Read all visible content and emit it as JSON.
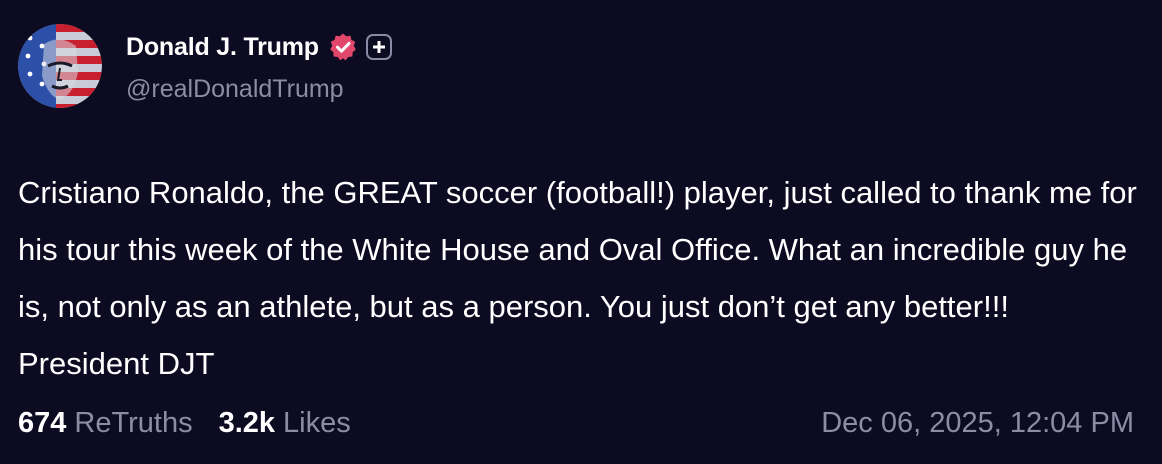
{
  "author": {
    "display_name": "Donald J. Trump",
    "handle": "@realDonaldTrump",
    "verified_icon": "verified-badge-icon",
    "plus_icon": "plus-square-icon"
  },
  "post": {
    "text": "Cristiano Ronaldo, the GREAT soccer (football!) player, just called to thank me for his tour this week of the White House and Oval Office. What an incredible guy he is, not only as an athlete, but as a person. You just don’t get any better!!! President DJT"
  },
  "stats": {
    "retruths_count": "674",
    "retruths_label": "ReTruths",
    "likes_count": "3.2k",
    "likes_label": "Likes"
  },
  "timestamp": "Dec 06, 2025, 12:04 PM",
  "colors": {
    "background": "#0d0b22",
    "text": "#ffffff",
    "muted": "#8c8ca6",
    "verified": "#e0476b"
  }
}
